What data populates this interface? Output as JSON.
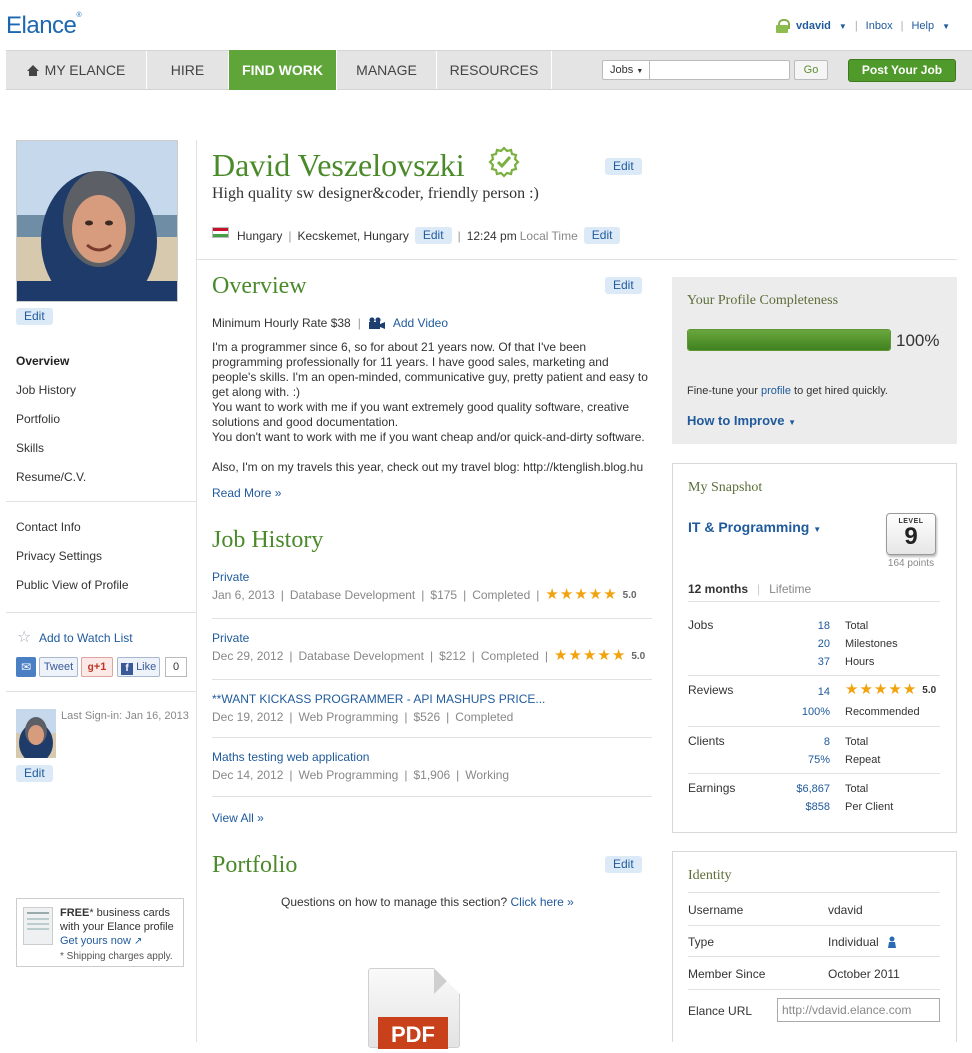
{
  "header": {
    "logo": "Elance",
    "user": "vdavid",
    "inbox": "Inbox",
    "help": "Help"
  },
  "nav": {
    "items": [
      "MY ELANCE",
      "HIRE",
      "FIND WORK",
      "MANAGE",
      "RESOURCES"
    ],
    "active": "FIND WORK",
    "search_scope": "Jobs",
    "go": "Go",
    "post_job": "Post Your Job"
  },
  "profile": {
    "name": "David Veszelovszki",
    "tagline": "High quality sw designer&coder, friendly person :)",
    "country": "Hungary",
    "city": "Kecskemet, Hungary",
    "time": "12:24 pm",
    "time_label": "Local Time",
    "edit": "Edit"
  },
  "sidebar": {
    "photo_edit": "Edit",
    "nav_group1": [
      "Overview",
      "Job History",
      "Portfolio",
      "Skills",
      "Resume/C.V."
    ],
    "nav_group2": [
      "Contact Info",
      "Privacy Settings",
      "Public View of Profile"
    ],
    "watch_list": "Add to Watch List",
    "tweet": "Tweet",
    "gplus": "+1",
    "like": "Like",
    "like_count": "0",
    "last_signin": "Last Sign-in: Jan 16, 2013",
    "avatar_edit": "Edit",
    "promo": {
      "free": "FREE",
      "line1": "* business cards",
      "line2": "with your Elance profile",
      "link": "Get yours now",
      "note": "* Shipping charges apply."
    }
  },
  "overview": {
    "title": "Overview",
    "rate": "Minimum Hourly Rate $38",
    "add_video": "Add Video",
    "body": [
      "I'm a programmer since 6, so for about 21 years now. Of that I've been programming professionally for 11 years. I have good sales, marketing and people's skills. I'm an open-minded, communicative guy, pretty patient and easy to get along with. :)",
      "You want to work with me if you want extremely good quality software, creative solutions and good documentation.",
      "You don't want to work with me if you want cheap and/or quick-and-dirty software.",
      "Also, I'm on my travels this year, check out my travel blog: http://ktenglish.blog.hu"
    ],
    "read_more": "Read More »"
  },
  "job_history": {
    "title": "Job History",
    "jobs": [
      {
        "title": "Private",
        "date": "Jan 6, 2013",
        "category": "Database Development",
        "amount": "$175",
        "status": "Completed",
        "rating": "5.0"
      },
      {
        "title": "Private",
        "date": "Dec 29, 2012",
        "category": "Database Development",
        "amount": "$212",
        "status": "Completed",
        "rating": "5.0"
      },
      {
        "title": "**WANT KICKASS PROGRAMMER - API MASHUPS PRICE...",
        "date": "Dec 19, 2012",
        "category": "Web Programming",
        "amount": "$526",
        "status": "Completed"
      },
      {
        "title": "Maths testing web application",
        "date": "Dec 14, 2012",
        "category": "Web Programming",
        "amount": "$1,906",
        "status": "Working"
      }
    ],
    "view_all": "View All »"
  },
  "portfolio": {
    "title": "Portfolio",
    "question": "Questions on how to manage this section?",
    "click_here": "Click here »",
    "pdf_label": "PDF"
  },
  "completeness": {
    "title": "Your Profile Completeness",
    "percent": 100,
    "percent_label": "100%",
    "tip_pre": "Fine-tune your",
    "tip_link": "profile",
    "tip_post": "to get hired quickly.",
    "how": "How to Improve"
  },
  "snapshot": {
    "title": "My Snapshot",
    "category": "IT & Programming",
    "level_label": "LEVEL",
    "level": "9",
    "points": "164 points",
    "period_active": "12 months",
    "period_other": "Lifetime",
    "rows": [
      {
        "label": "Jobs",
        "items": [
          {
            "num": "18",
            "label": "Total"
          },
          {
            "num": "20",
            "label": "Milestones"
          },
          {
            "num": "37",
            "label": "Hours"
          }
        ]
      },
      {
        "label": "Reviews",
        "items": [
          {
            "num": "14",
            "label": "5.0"
          },
          {
            "num": "100%",
            "label": "Recommended"
          }
        ]
      },
      {
        "label": "Clients",
        "items": [
          {
            "num": "8",
            "label": "Total"
          },
          {
            "num": "75%",
            "label": "Repeat"
          }
        ]
      },
      {
        "label": "Earnings",
        "items": [
          {
            "num": "$6,867",
            "label": "Total"
          },
          {
            "num": "$858",
            "label": "Per Client"
          }
        ]
      }
    ]
  },
  "identity": {
    "title": "Identity",
    "rows": [
      {
        "label": "Username",
        "value": "vdavid"
      },
      {
        "label": "Type",
        "value": "Individual"
      },
      {
        "label": "Member Since",
        "value": "October 2011"
      },
      {
        "label": "Elance URL",
        "value": "http://vdavid.elance.com"
      }
    ]
  },
  "colors": {
    "brand_green": "#5fa53a",
    "link_blue": "#1f5a9c",
    "title_green": "#4a8a2a"
  }
}
